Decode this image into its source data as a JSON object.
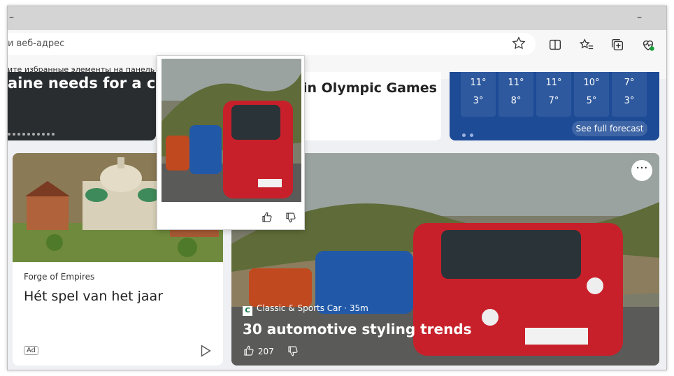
{
  "browser": {
    "minimize_glyph": "–",
    "address_placeholder": "и веб-адрес",
    "favorites_bar_text": "ите избранные элементы на панель \"\""
  },
  "cards": {
    "top_left": {
      "title": "aine needs for a ceas"
    },
    "top_middle": {
      "title": "in Olympic Games"
    },
    "weather": {
      "days": [
        {
          "hi": "11°",
          "lo": "3°"
        },
        {
          "hi": "11°",
          "lo": "8°"
        },
        {
          "hi": "11°",
          "lo": "7°"
        },
        {
          "hi": "10°",
          "lo": "5°"
        },
        {
          "hi": "7°",
          "lo": "3°"
        }
      ],
      "forecast_button": "See full forecast"
    },
    "ad": {
      "source": "Forge of Empires",
      "title": "Hét spel van het jaar",
      "badge": "Ad"
    },
    "main": {
      "source": "Classic & Sports Car · 35m",
      "source_logo": "C",
      "title": "30 automotive styling trends",
      "likes": "207",
      "more_glyph": "···"
    }
  },
  "colors": {
    "weather_bg": "#1d4b96",
    "car_red": "#c8202a",
    "car_blue": "#2159a8"
  }
}
